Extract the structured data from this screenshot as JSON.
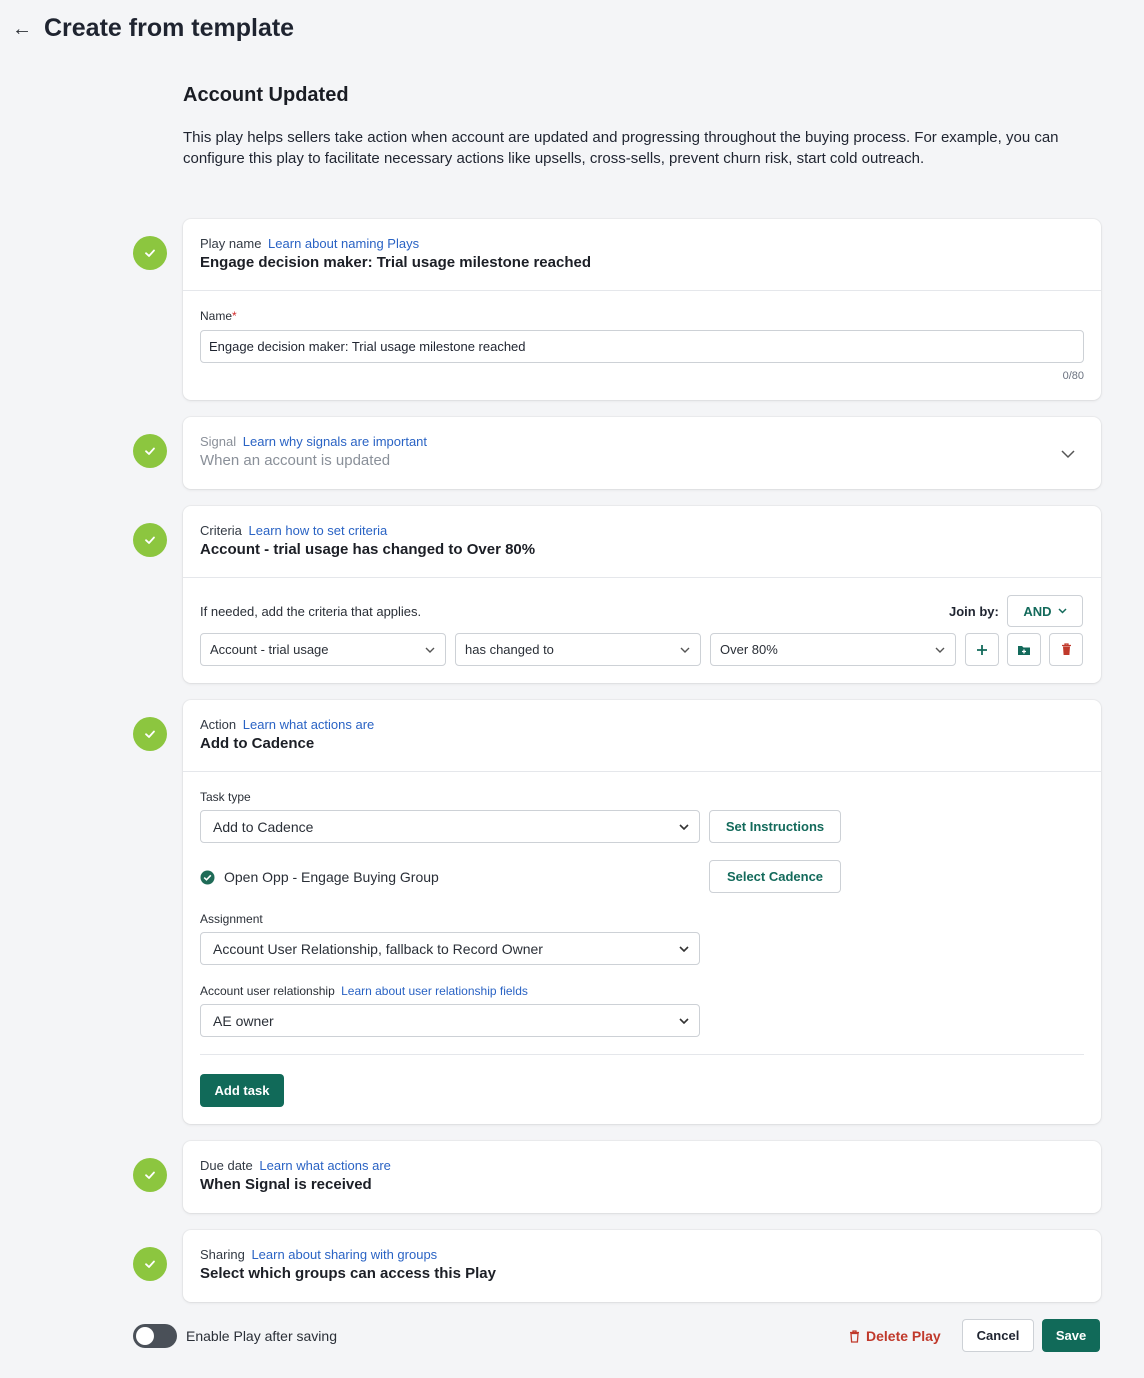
{
  "header": {
    "title": "Create from template"
  },
  "intro": {
    "title": "Account Updated",
    "description": "This play helps sellers take action when account are updated and progressing throughout the buying process. For example, you can configure this play to facilitate necessary actions like upsells, cross-sells, prevent churn risk, start cold outreach."
  },
  "play_name": {
    "kicker": "Play name",
    "link": "Learn about naming Plays",
    "headline": "Engage decision maker: Trial usage milestone reached",
    "field_label": "Name",
    "required_mark": "*",
    "value": "Engage decision maker: Trial usage milestone reached",
    "counter": "0/80"
  },
  "signal": {
    "kicker": "Signal",
    "link": "Learn why signals are important",
    "headline": "When an account is updated"
  },
  "criteria": {
    "kicker": "Criteria",
    "link": "Learn how to set criteria",
    "headline": "Account - trial usage has changed to Over 80%",
    "hint": "If needed, add the criteria that applies.",
    "join_label": "Join by:",
    "join_value": "AND",
    "field": "Account - trial usage",
    "operator": "has changed to",
    "value": "Over 80%"
  },
  "action": {
    "kicker": "Action",
    "link": "Learn what actions are",
    "headline": "Add to Cadence",
    "task_type_label": "Task type",
    "task_type_value": "Add to Cadence",
    "set_instructions": "Set Instructions",
    "selected_cadence": "Open Opp - Engage Buying Group",
    "select_cadence": "Select Cadence",
    "assignment_label": "Assignment",
    "assignment_value": "Account User Relationship, fallback to Record Owner",
    "relationship_label": "Account user relationship",
    "relationship_link": "Learn about user relationship fields",
    "relationship_value": "AE owner",
    "add_task": "Add task"
  },
  "due_date": {
    "kicker": "Due date",
    "link": "Learn what actions are",
    "headline": "When Signal is received"
  },
  "sharing": {
    "kicker": "Sharing",
    "link": "Learn about sharing with groups",
    "headline": "Select which groups can access this Play"
  },
  "footer": {
    "toggle_label": "Enable Play after saving",
    "toggle_on": false,
    "delete": "Delete Play",
    "cancel": "Cancel",
    "save": "Save"
  },
  "colors": {
    "check": "#8cc63f",
    "primary": "#116a59",
    "link": "#2a63c4",
    "danger": "#c0392b"
  }
}
